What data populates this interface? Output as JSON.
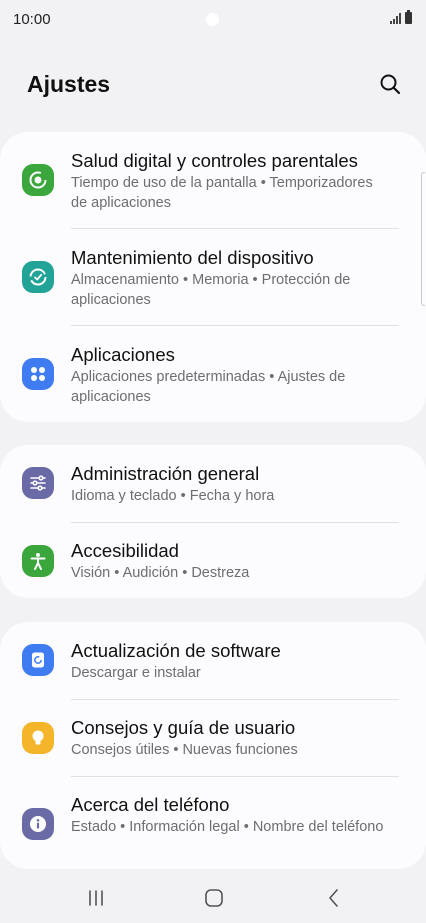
{
  "status_bar": {
    "time": "10:00"
  },
  "header": {
    "title": "Ajustes"
  },
  "cards": [
    {
      "items": [
        {
          "title": "Salud digital y controles parentales",
          "subtitle": "Tiempo de uso de la pantalla  •  Temporizadores de aplicaciones",
          "icon": "digital-wellbeing-icon",
          "color": "#3aa63b"
        },
        {
          "title": "Mantenimiento del dispositivo",
          "subtitle": "Almacenamiento  •  Memoria  •  Protección de aplicaciones",
          "icon": "device-care-icon",
          "color": "#22a398"
        },
        {
          "title": "Aplicaciones",
          "subtitle": "Aplicaciones predeterminadas  •  Ajustes de aplicaciones",
          "icon": "apps-icon",
          "color": "#3f7cf2"
        }
      ]
    },
    {
      "items": [
        {
          "title": "Administración general",
          "subtitle": "Idioma y teclado  •  Fecha y hora",
          "icon": "sliders-icon",
          "color": "#6a6ba6"
        },
        {
          "title": "Accesibilidad",
          "subtitle": "Visión  •  Audición  •  Destreza",
          "icon": "accessibility-icon",
          "color": "#3aa63b"
        }
      ]
    },
    {
      "items": [
        {
          "title": "Actualización de software",
          "subtitle": "Descargar e instalar",
          "icon": "software-update-icon",
          "color": "#3f7cf2"
        },
        {
          "title": "Consejos y guía de usuario",
          "subtitle": "Consejos útiles  •  Nuevas funciones",
          "icon": "lightbulb-icon",
          "color": "#f4b52a"
        },
        {
          "title": "Acerca del teléfono",
          "subtitle": "Estado  •  Información legal  •  Nombre del teléfono",
          "icon": "info-icon",
          "color": "#6a6ba6"
        }
      ]
    }
  ]
}
